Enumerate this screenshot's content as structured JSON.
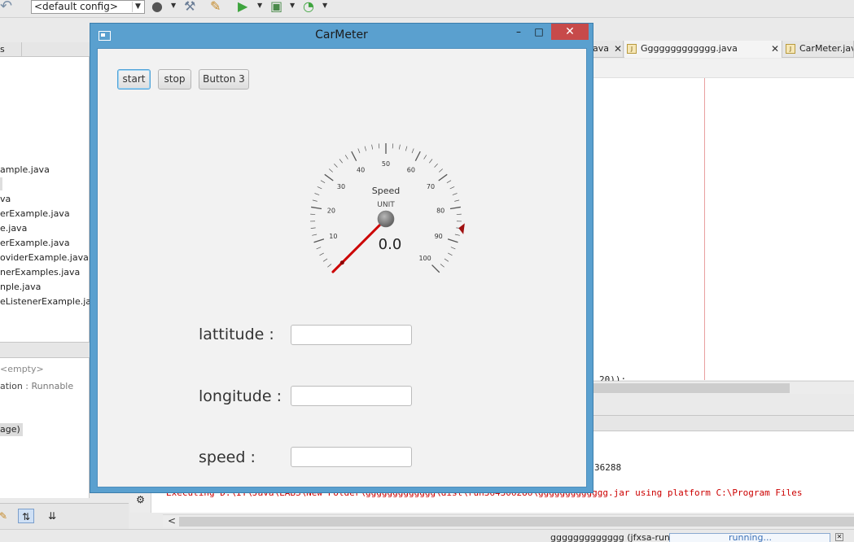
{
  "ide": {
    "config_select": "<default config>",
    "left_panel_header": "s",
    "files": [
      "ample.java",
      "va",
      "erExample.java",
      "e.java",
      "erExample.java",
      "oviderExample.java",
      "nerExamples.java",
      "nple.java",
      "eListenerExample.java"
    ],
    "navigator_empty": "<empty>",
    "navigator_item_name": "ation",
    "navigator_item_type": " : Runnable",
    "navigator_page": "age)",
    "editor_tabs": [
      "ava",
      "Ggggggggggggg.java",
      "CarMeter.java"
    ],
    "code_fragment": "20));",
    "output_line1": "36288",
    "output_line2": "Executing D:\\IT\\Java\\LABS\\New Folder\\ggggggggggggg\\dist\\run364306286\\ggggggggggggg.jar using platform C:\\Program Files",
    "status_task": "ggggggggggggg (jfxsa-run)",
    "status_progress": "running..."
  },
  "window": {
    "title": "CarMeter",
    "min_glyph": "–",
    "max_glyph": "□",
    "close_glyph": "✕"
  },
  "buttons": {
    "start": "start",
    "stop": "stop",
    "button3": "Button 3"
  },
  "gauge": {
    "title": "Speed",
    "unit": "UNIT",
    "value": "0.0",
    "numeric_value": 0,
    "min": 0,
    "max": 100,
    "tick_labels": [
      "10",
      "20",
      "30",
      "40",
      "50",
      "60",
      "70",
      "80",
      "90",
      "100"
    ],
    "needle_color": "#cc0000",
    "marker_color": "#a01010"
  },
  "fields": {
    "latitude_label": "lattitude :",
    "latitude_value": "",
    "longitude_label": "longitude :",
    "longitude_value": "",
    "speed_label": "speed :",
    "speed_value": ""
  }
}
